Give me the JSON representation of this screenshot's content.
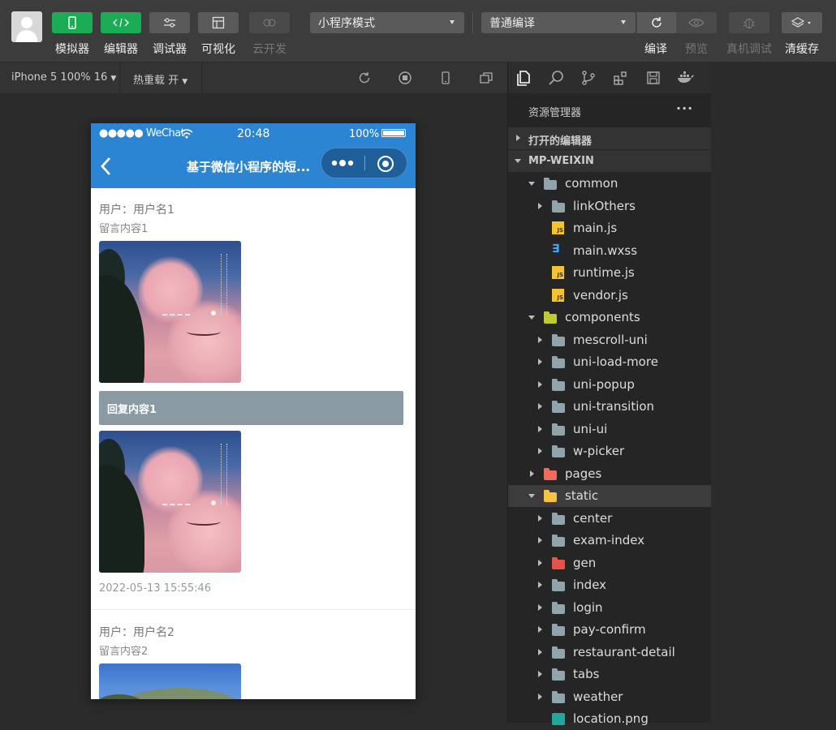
{
  "toolbar": {
    "buttons": [
      {
        "label": "模拟器",
        "icon": "phone-icon"
      },
      {
        "label": "编辑器",
        "icon": "code-icon"
      },
      {
        "label": "调试器",
        "icon": "debug-icon"
      },
      {
        "label": "可视化",
        "icon": "layout-icon"
      },
      {
        "label": "云开发",
        "icon": "cloud-icon"
      }
    ],
    "mode_select": "小程序模式",
    "compile_select": "普通编译",
    "right_buttons": [
      {
        "label": "编译",
        "icon": "refresh-icon"
      },
      {
        "label": "预览",
        "icon": "eye-icon"
      },
      {
        "label": "真机调试",
        "icon": "bug-icon"
      },
      {
        "label": "清缓存",
        "icon": "layers-icon"
      }
    ]
  },
  "subbar": {
    "device": "iPhone 5 100% 16",
    "hot_reload": "热重载 开"
  },
  "phone": {
    "status": {
      "carrier": "●●●●● WeChat",
      "time": "20:48",
      "battery": "100%"
    },
    "nav_title": "基于微信小程序的短...",
    "messages": [
      {
        "user": "用户：用户名1",
        "text": "留言内容1",
        "reply": "回复内容1",
        "time": "2022-05-13 15:55:46"
      },
      {
        "user": "用户：用户名2",
        "text": "留言内容2"
      }
    ]
  },
  "explorer": {
    "title": "资源管理器",
    "more": "···",
    "open_editors": "打开的编辑器",
    "project": "MP-WEIXIN",
    "tree": [
      "common",
      "linkOthers",
      "main.js",
      "main.wxss",
      "runtime.js",
      "vendor.js",
      "components",
      "mescroll-uni",
      "uni-load-more",
      "uni-popup",
      "uni-transition",
      "uni-ui",
      "w-picker",
      "pages",
      "static",
      "center",
      "exam-index",
      "gen",
      "index",
      "login",
      "pay-confirm",
      "restaurant-detail",
      "tabs",
      "weather",
      "location.png"
    ]
  }
}
